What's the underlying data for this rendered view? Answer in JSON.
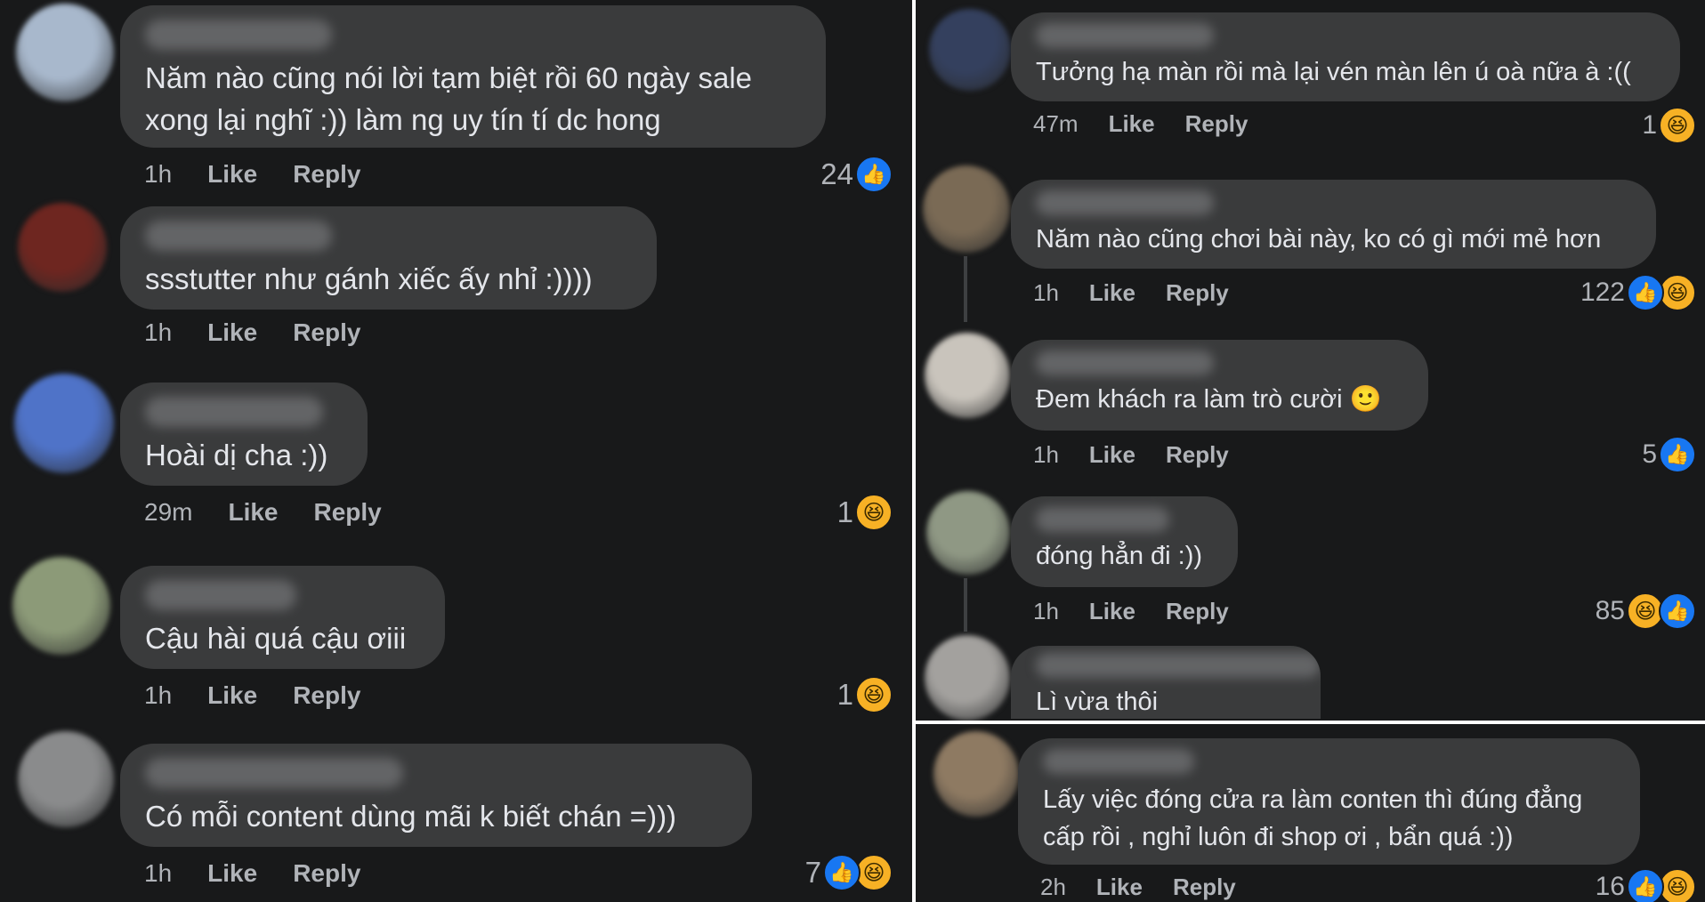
{
  "actions": {
    "like": "Like",
    "reply": "Reply"
  },
  "left": [
    {
      "text": "Năm nào cũng nói lời tạm biệt rồi 60 ngày sale\nxong lại nghĩ :)) làm ng uy tín tí dc hong",
      "time": "1h",
      "count": "24",
      "reactions": [
        "like"
      ],
      "avatar_color": "#a8b8cc"
    },
    {
      "text": "ssstutter như gánh xiếc ấy nhỉ :))))",
      "time": "1h",
      "count": "",
      "reactions": [],
      "avatar_color": "#6e2620"
    },
    {
      "text": "Hoài dị cha :))",
      "time": "29m",
      "count": "1",
      "reactions": [
        "haha"
      ],
      "avatar_color": "#4f73c8"
    },
    {
      "text": "Cậu hài quá cậu ơiii",
      "time": "1h",
      "count": "1",
      "reactions": [
        "haha"
      ],
      "avatar_color": "#8c9a78"
    },
    {
      "text": "Có mỗi content dùng mãi k biết chán =)))",
      "time": "1h",
      "count": "7",
      "reactions": [
        "like",
        "haha"
      ],
      "avatar_color": "#8a8b8c"
    }
  ],
  "right": [
    {
      "text": "Tưởng hạ màn rồi mà lại vén màn lên ú oà nữa à :((",
      "time": "47m",
      "count": "1",
      "reactions": [
        "haha"
      ],
      "avatar_color": "#34405e"
    },
    {
      "text": "Năm nào cũng chơi bài này, ko có gì mới mẻ hơn",
      "time": "1h",
      "count": "122",
      "reactions": [
        "like",
        "haha"
      ],
      "avatar_color": "#7a6a55"
    },
    {
      "text": "Đem khách ra làm trò cười 🙂",
      "time": "1h",
      "count": "5",
      "reactions": [
        "like"
      ],
      "avatar_color": "#c9c4bc"
    },
    {
      "text": "đóng hẳn đi :))",
      "time": "1h",
      "count": "85",
      "reactions": [
        "haha",
        "like"
      ],
      "avatar_color": "#8f9884"
    },
    {
      "text": "Lì vừa thôi",
      "time": "",
      "count": "",
      "reactions": [],
      "avatar_color": "#a3a19e"
    },
    {
      "text": "Lấy việc đóng cửa ra làm conten thì đúng đẳng\ncấp rồi , nghỉ luôn đi shop ơi , bẩn quá :))",
      "time": "2h",
      "count": "16",
      "reactions": [
        "like",
        "haha"
      ],
      "avatar_color": "#8e7a62"
    }
  ]
}
